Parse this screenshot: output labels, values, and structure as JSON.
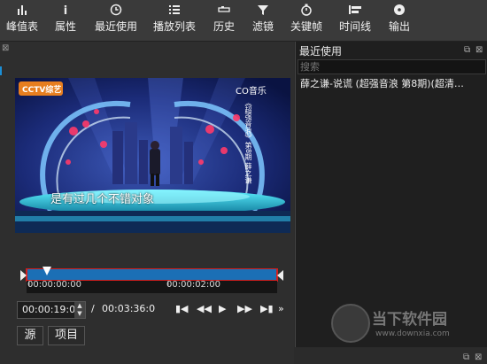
{
  "toolbar": {
    "items": [
      {
        "label": "峰值表",
        "icon": "peak-meter-icon"
      },
      {
        "label": "属性",
        "icon": "info-icon"
      },
      {
        "label": "最近使用",
        "icon": "clock-icon"
      },
      {
        "label": "播放列表",
        "icon": "list-icon"
      },
      {
        "label": "历史",
        "icon": "history-icon"
      },
      {
        "label": "滤镜",
        "icon": "filter-icon"
      },
      {
        "label": "关键帧",
        "icon": "stopwatch-icon"
      },
      {
        "label": "时间线",
        "icon": "timeline-icon"
      },
      {
        "label": "输出",
        "icon": "disc-icon"
      }
    ]
  },
  "video": {
    "caption": "是有过几个不错对象",
    "channel_logo": "CCTV综艺",
    "music_logo": "CO音乐",
    "side_text": "《超强音浪》第8期 薛之谦"
  },
  "timeline": {
    "tick_start": "00:00:00:00",
    "tick_mid": "00:00:02:00",
    "progress": 0.08
  },
  "transport": {
    "current_time": "00:00:19:0",
    "separator": "/",
    "total_time": "00:03:36:0"
  },
  "tabs": {
    "source": "源",
    "project": "项目"
  },
  "recent_panel": {
    "title": "最近使用",
    "search_placeholder": "搜索",
    "items": [
      "薛之谦-说谎 (超强音浪 第8期)(超清…"
    ]
  },
  "watermark": {
    "brand": "当下软件园",
    "url": "www.downxia.com"
  },
  "colors": {
    "accent_red": "#d21e1e",
    "timeline_blue": "#1b6fb5"
  }
}
